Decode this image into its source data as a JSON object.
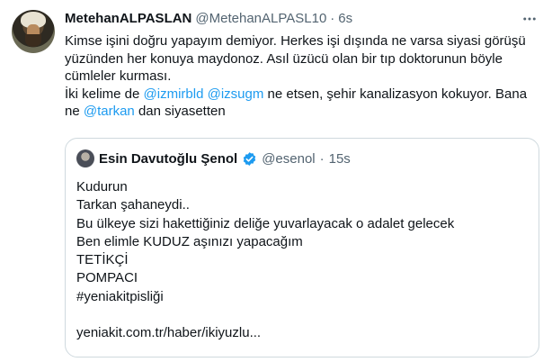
{
  "tweet": {
    "display_name": "MetehanALPASLAN",
    "handle": "@MetehanALPASL10",
    "separator": "·",
    "time": "6s",
    "more_icon": "more-horizontal-icon",
    "text": {
      "line1": "Kimse işini doğru yapayım demiyor. Herkes işi dışında ne varsa siyasi görüşü",
      "line2": "yüzünden her konuya maydonoz. Asıl üzücü olan bir tıp doktorunun böyle",
      "line3": "cümleler kurması.",
      "line4_a": "İki kelime de ",
      "mention1": "@izmirbld",
      "line4_space": " ",
      "mention2": "@izsugm",
      "line4_b": " ne etsen, şehir kanalizasyon kokuyor. Bana",
      "line5_a": "ne ",
      "mention3": "@tarkan",
      "line5_b": " dan siyasetten"
    }
  },
  "quoted": {
    "display_name": "Esin Davutoğlu Şenol",
    "verified_icon": "verified-badge-icon",
    "handle": "@esenol",
    "separator": "·",
    "time": "15s",
    "lines": [
      "Kudurun",
      "Tarkan şahaneydi..",
      "Bu ülkeye sizi hakettiğiniz deliğe yuvarlayacak o adalet gelecek",
      "Ben elimle KUDUZ aşınızı yapacağım",
      "TETİKÇİ",
      "POMPACI",
      "#yeniakitpisliği",
      "",
      "yeniakit.com.tr/haber/ikiyuzlu..."
    ]
  },
  "colors": {
    "text": "#0f1419",
    "secondary": "#536471",
    "link": "#1d9bf0",
    "border": "#cfd9de"
  }
}
